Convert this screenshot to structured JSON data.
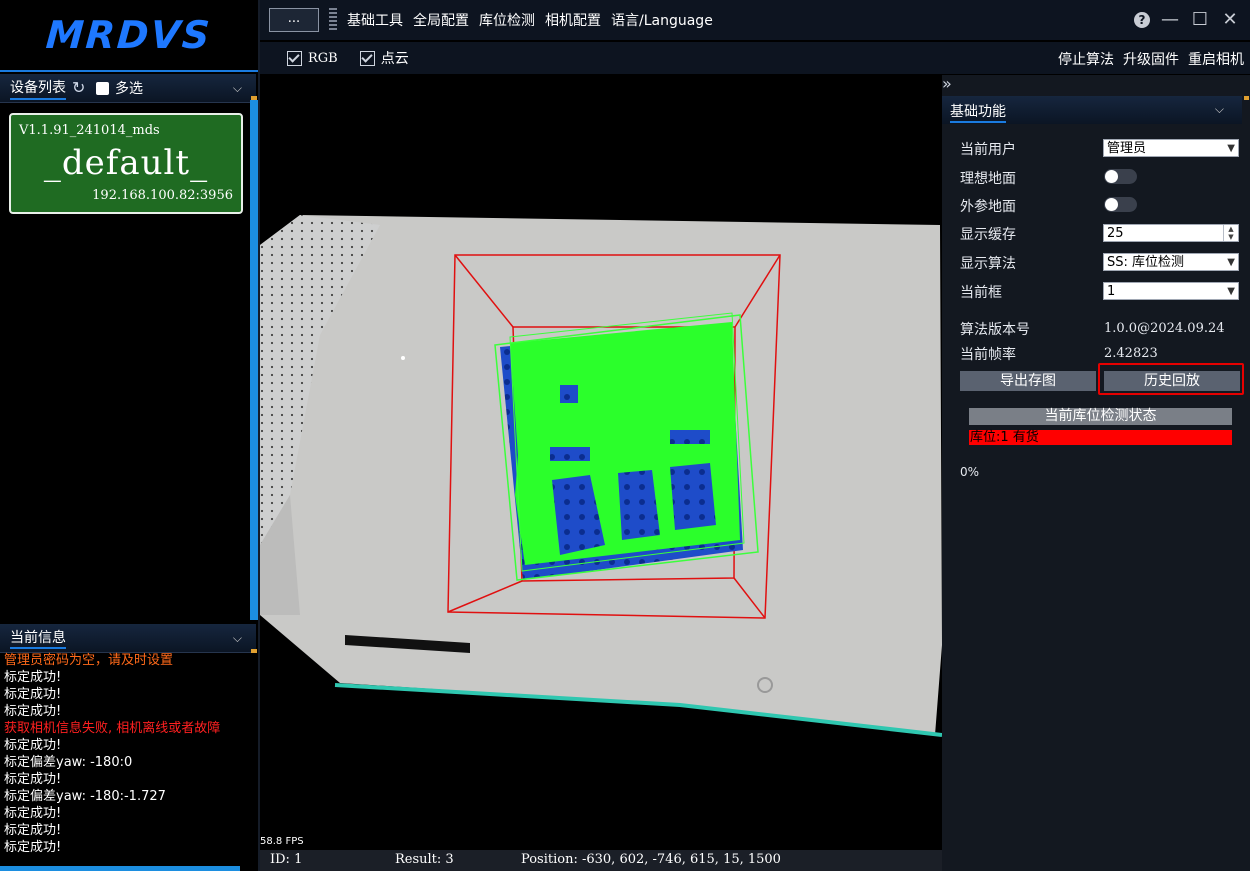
{
  "app": {
    "logo": "MRDVS"
  },
  "menu": {
    "more": "...",
    "items": [
      "基础工具",
      "全局配置",
      "库位检测",
      "相机配置",
      "语言/Language"
    ],
    "window_controls": [
      "help-icon",
      "minimize-icon",
      "maximize-icon",
      "close-icon"
    ]
  },
  "subtoolbar": {
    "checkboxes": [
      {
        "label": "RGB",
        "checked": true
      },
      {
        "label": "点云",
        "checked": true
      }
    ],
    "actions": [
      "停止算法",
      "升级固件",
      "重启相机"
    ]
  },
  "device_panel": {
    "title": "设备列表",
    "multi_select": "多选",
    "device": {
      "version": "V1.1.91_241014_mds",
      "name": "_default_",
      "address": "192.168.100.82:3956",
      "color": "#1f6b22"
    }
  },
  "info_panel": {
    "title": "当前信息",
    "log": [
      {
        "text": "管理员密码为空，请及时设置",
        "color": "#ff6a1a"
      },
      {
        "text": "标定成功!",
        "color": "#ffffff"
      },
      {
        "text": "标定成功!",
        "color": "#ffffff"
      },
      {
        "text": "标定成功!",
        "color": "#ffffff"
      },
      {
        "text": "获取相机信息失败, 相机离线或者故障",
        "color": "#ff2020"
      },
      {
        "text": "标定成功!",
        "color": "#ffffff"
      },
      {
        "text": "标定偏差yaw: -180:0",
        "color": "#ffffff"
      },
      {
        "text": "标定成功!",
        "color": "#ffffff"
      },
      {
        "text": "标定偏差yaw: -180:-1.727",
        "color": "#ffffff"
      },
      {
        "text": "标定成功!",
        "color": "#ffffff"
      },
      {
        "text": "标定成功!",
        "color": "#ffffff"
      },
      {
        "text": "标定成功!",
        "color": "#ffffff"
      }
    ]
  },
  "viewport": {
    "fps": "58.8 FPS",
    "status": {
      "id": "ID: 1",
      "result": "Result: 3",
      "position": "Position: -630, 602, -746, 615, 15, 1500"
    }
  },
  "basic_panel": {
    "title": "基础功能",
    "current_user_label": "当前用户",
    "current_user_value": "管理员",
    "ideal_ground_label": "理想地面",
    "ideal_ground_on": false,
    "extrinsic_ground_label": "外参地面",
    "extrinsic_ground_on": false,
    "display_cache_label": "显示缓存",
    "display_cache_value": "25",
    "display_algo_label": "显示算法",
    "display_algo_value": "SS: 库位检测",
    "current_frame_label": "当前框",
    "current_frame_value": "1",
    "algo_version_label": "算法版本号",
    "algo_version_value": "1.0.0@2024.09.24",
    "frame_rate_label": "当前帧率",
    "frame_rate_value": "2.42823",
    "export_button": "导出存图",
    "history_button": "历史回放",
    "status_title": "当前库位检测状态",
    "bay_status": "库位:1 有货",
    "bay_status_color": "#ff0000",
    "progress": "0%"
  }
}
